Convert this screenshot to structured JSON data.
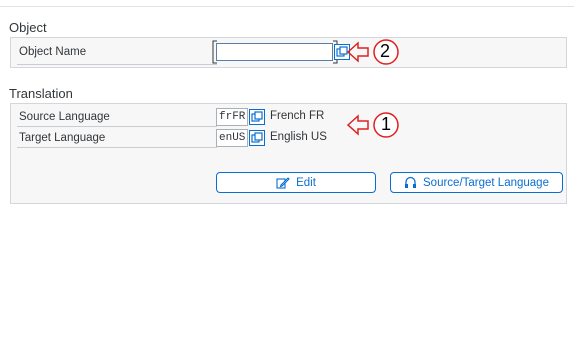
{
  "object_section": {
    "title": "Object",
    "object_name_label": "Object Name",
    "object_name_value": ""
  },
  "translation_section": {
    "title": "Translation",
    "source_language_label": "Source Language",
    "source_language_code": "frFR",
    "source_language_desc": "French FR",
    "target_language_label": "Target Language",
    "target_language_code": "enUS",
    "target_language_desc": "English US"
  },
  "buttons": {
    "edit_label": "Edit",
    "source_target_label": "Source/Target Language"
  },
  "annotations": {
    "callout_1": "1",
    "callout_2": "2",
    "color": "#e02020"
  },
  "colors": {
    "accent": "#0a6ed1",
    "group_bg": "#f7f7f7"
  }
}
